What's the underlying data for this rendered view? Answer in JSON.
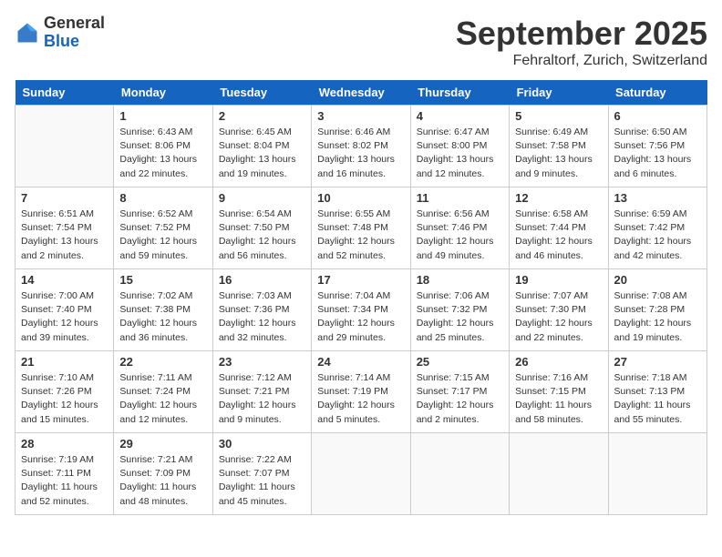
{
  "header": {
    "logo_general": "General",
    "logo_blue": "Blue",
    "month_title": "September 2025",
    "location": "Fehraltorf, Zurich, Switzerland"
  },
  "days_of_week": [
    "Sunday",
    "Monday",
    "Tuesday",
    "Wednesday",
    "Thursday",
    "Friday",
    "Saturday"
  ],
  "weeks": [
    [
      {
        "day": "",
        "sunrise": "",
        "sunset": "",
        "daylight": ""
      },
      {
        "day": "1",
        "sunrise": "Sunrise: 6:43 AM",
        "sunset": "Sunset: 8:06 PM",
        "daylight": "Daylight: 13 hours and 22 minutes."
      },
      {
        "day": "2",
        "sunrise": "Sunrise: 6:45 AM",
        "sunset": "Sunset: 8:04 PM",
        "daylight": "Daylight: 13 hours and 19 minutes."
      },
      {
        "day": "3",
        "sunrise": "Sunrise: 6:46 AM",
        "sunset": "Sunset: 8:02 PM",
        "daylight": "Daylight: 13 hours and 16 minutes."
      },
      {
        "day": "4",
        "sunrise": "Sunrise: 6:47 AM",
        "sunset": "Sunset: 8:00 PM",
        "daylight": "Daylight: 13 hours and 12 minutes."
      },
      {
        "day": "5",
        "sunrise": "Sunrise: 6:49 AM",
        "sunset": "Sunset: 7:58 PM",
        "daylight": "Daylight: 13 hours and 9 minutes."
      },
      {
        "day": "6",
        "sunrise": "Sunrise: 6:50 AM",
        "sunset": "Sunset: 7:56 PM",
        "daylight": "Daylight: 13 hours and 6 minutes."
      }
    ],
    [
      {
        "day": "7",
        "sunrise": "Sunrise: 6:51 AM",
        "sunset": "Sunset: 7:54 PM",
        "daylight": "Daylight: 13 hours and 2 minutes."
      },
      {
        "day": "8",
        "sunrise": "Sunrise: 6:52 AM",
        "sunset": "Sunset: 7:52 PM",
        "daylight": "Daylight: 12 hours and 59 minutes."
      },
      {
        "day": "9",
        "sunrise": "Sunrise: 6:54 AM",
        "sunset": "Sunset: 7:50 PM",
        "daylight": "Daylight: 12 hours and 56 minutes."
      },
      {
        "day": "10",
        "sunrise": "Sunrise: 6:55 AM",
        "sunset": "Sunset: 7:48 PM",
        "daylight": "Daylight: 12 hours and 52 minutes."
      },
      {
        "day": "11",
        "sunrise": "Sunrise: 6:56 AM",
        "sunset": "Sunset: 7:46 PM",
        "daylight": "Daylight: 12 hours and 49 minutes."
      },
      {
        "day": "12",
        "sunrise": "Sunrise: 6:58 AM",
        "sunset": "Sunset: 7:44 PM",
        "daylight": "Daylight: 12 hours and 46 minutes."
      },
      {
        "day": "13",
        "sunrise": "Sunrise: 6:59 AM",
        "sunset": "Sunset: 7:42 PM",
        "daylight": "Daylight: 12 hours and 42 minutes."
      }
    ],
    [
      {
        "day": "14",
        "sunrise": "Sunrise: 7:00 AM",
        "sunset": "Sunset: 7:40 PM",
        "daylight": "Daylight: 12 hours and 39 minutes."
      },
      {
        "day": "15",
        "sunrise": "Sunrise: 7:02 AM",
        "sunset": "Sunset: 7:38 PM",
        "daylight": "Daylight: 12 hours and 36 minutes."
      },
      {
        "day": "16",
        "sunrise": "Sunrise: 7:03 AM",
        "sunset": "Sunset: 7:36 PM",
        "daylight": "Daylight: 12 hours and 32 minutes."
      },
      {
        "day": "17",
        "sunrise": "Sunrise: 7:04 AM",
        "sunset": "Sunset: 7:34 PM",
        "daylight": "Daylight: 12 hours and 29 minutes."
      },
      {
        "day": "18",
        "sunrise": "Sunrise: 7:06 AM",
        "sunset": "Sunset: 7:32 PM",
        "daylight": "Daylight: 12 hours and 25 minutes."
      },
      {
        "day": "19",
        "sunrise": "Sunrise: 7:07 AM",
        "sunset": "Sunset: 7:30 PM",
        "daylight": "Daylight: 12 hours and 22 minutes."
      },
      {
        "day": "20",
        "sunrise": "Sunrise: 7:08 AM",
        "sunset": "Sunset: 7:28 PM",
        "daylight": "Daylight: 12 hours and 19 minutes."
      }
    ],
    [
      {
        "day": "21",
        "sunrise": "Sunrise: 7:10 AM",
        "sunset": "Sunset: 7:26 PM",
        "daylight": "Daylight: 12 hours and 15 minutes."
      },
      {
        "day": "22",
        "sunrise": "Sunrise: 7:11 AM",
        "sunset": "Sunset: 7:24 PM",
        "daylight": "Daylight: 12 hours and 12 minutes."
      },
      {
        "day": "23",
        "sunrise": "Sunrise: 7:12 AM",
        "sunset": "Sunset: 7:21 PM",
        "daylight": "Daylight: 12 hours and 9 minutes."
      },
      {
        "day": "24",
        "sunrise": "Sunrise: 7:14 AM",
        "sunset": "Sunset: 7:19 PM",
        "daylight": "Daylight: 12 hours and 5 minutes."
      },
      {
        "day": "25",
        "sunrise": "Sunrise: 7:15 AM",
        "sunset": "Sunset: 7:17 PM",
        "daylight": "Daylight: 12 hours and 2 minutes."
      },
      {
        "day": "26",
        "sunrise": "Sunrise: 7:16 AM",
        "sunset": "Sunset: 7:15 PM",
        "daylight": "Daylight: 11 hours and 58 minutes."
      },
      {
        "day": "27",
        "sunrise": "Sunrise: 7:18 AM",
        "sunset": "Sunset: 7:13 PM",
        "daylight": "Daylight: 11 hours and 55 minutes."
      }
    ],
    [
      {
        "day": "28",
        "sunrise": "Sunrise: 7:19 AM",
        "sunset": "Sunset: 7:11 PM",
        "daylight": "Daylight: 11 hours and 52 minutes."
      },
      {
        "day": "29",
        "sunrise": "Sunrise: 7:21 AM",
        "sunset": "Sunset: 7:09 PM",
        "daylight": "Daylight: 11 hours and 48 minutes."
      },
      {
        "day": "30",
        "sunrise": "Sunrise: 7:22 AM",
        "sunset": "Sunset: 7:07 PM",
        "daylight": "Daylight: 11 hours and 45 minutes."
      },
      {
        "day": "",
        "sunrise": "",
        "sunset": "",
        "daylight": ""
      },
      {
        "day": "",
        "sunrise": "",
        "sunset": "",
        "daylight": ""
      },
      {
        "day": "",
        "sunrise": "",
        "sunset": "",
        "daylight": ""
      },
      {
        "day": "",
        "sunrise": "",
        "sunset": "",
        "daylight": ""
      }
    ]
  ]
}
